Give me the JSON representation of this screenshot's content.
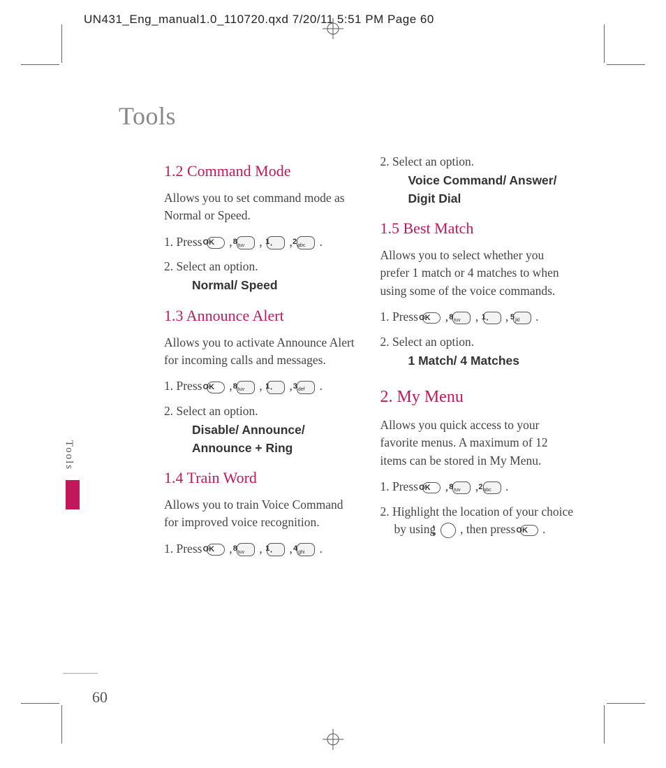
{
  "header": "UN431_Eng_manual1.0_110720.qxd  7/20/11  5:51 PM  Page 60",
  "page_title": "Tools",
  "side_tab": "Tools",
  "page_number": "60",
  "keys": {
    "ok": "OK",
    "k1": "1",
    "k2": "2",
    "k3": "3",
    "k4": "4",
    "k5": "5",
    "k8": "8",
    "s_tuv": "tuv",
    "s_abc": "abc",
    "s_def": "def",
    "s_ghi": "ghi",
    "s_jkl": "jkl"
  },
  "left": {
    "s12_h": "1.2 Command Mode",
    "s12_p": "Allows you to set command mode as Normal or Speed.",
    "s12_1a": "1. Press ",
    "s12_2": "2. Select an option.",
    "s12_opt": "Normal/ Speed",
    "s13_h": "1.3 Announce Alert",
    "s13_p": "Allows you to activate Announce Alert for incoming calls and messages.",
    "s13_1a": "1. Press ",
    "s13_2": "2. Select an option.",
    "s13_opt": "Disable/ Announce/ Announce + Ring",
    "s14_h": "1.4 Train Word",
    "s14_p": "Allows you to train Voice Command for improved voice recognition.",
    "s14_1a": "1. Press "
  },
  "right": {
    "s14_2": "2. Select an option.",
    "s14_opt": "Voice Command/ Answer/ Digit Dial",
    "s15_h": "1.5 Best Match",
    "s15_p": "Allows you to select whether you prefer 1 match or 4 matches to when using some of the voice commands.",
    "s15_1a": "1. Press ",
    "s15_2": "2. Select an option.",
    "s15_opt": "1 Match/ 4 Matches",
    "s2_h": "2. My Menu",
    "s2_p": "Allows you quick access to your favorite menus. A maximum of 12 items can be stored in My Menu.",
    "s2_1a": "1. Press ",
    "s2_2a": "2. Highlight the location of your choice by using ",
    "s2_2b": " , then press ",
    "s2_2c": " ."
  }
}
